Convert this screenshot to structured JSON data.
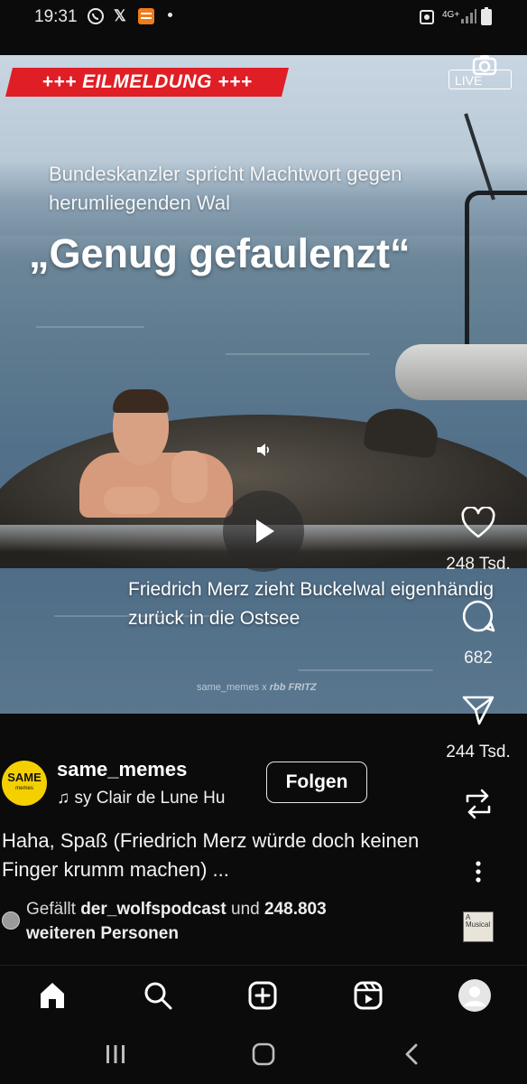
{
  "status_bar": {
    "time": "19:31",
    "network": "4G+",
    "notification_icons": [
      "whatsapp-icon",
      "x-icon",
      "app-badge-icon"
    ]
  },
  "post": {
    "breaking_banner": "+++ EILMELDUNG +++",
    "live_label": "LIVE",
    "subheadline": "Bundeskanzler spricht Machtwort gegen herumliegenden Wal",
    "headline": "„Genug gefaulenzt“",
    "caption": "Friedrich Merz zieht Buckelwal eigenhändig zurück in die Ostsee",
    "watermark": "same_memes x",
    "watermark_brand": "rbb FRITZ"
  },
  "actions": {
    "likes": "248 Tsd.",
    "comments": "682",
    "shares": "244 Tsd."
  },
  "author": {
    "avatar_text": "SAME",
    "avatar_sub": "memes",
    "username": "same_memes",
    "music": "sy Clair de Lune   Hu",
    "follow_label": "Folgen"
  },
  "description": "Haha, Spaß (Friedrich Merz würde doch keinen Finger krumm machen) ...",
  "likes_line": {
    "prefix": "Gefällt ",
    "user": "der_wolfspodcast",
    "middle": " und ",
    "count": "248.803",
    "suffix": "weiteren Personen"
  },
  "album_text": "A Musical",
  "bottom_nav": [
    "home-icon",
    "search-icon",
    "create-icon",
    "reels-icon",
    "profile-icon"
  ],
  "system_nav": [
    "recents-icon",
    "home-button-icon",
    "back-icon"
  ],
  "colors": {
    "background": "#0b0b0c",
    "banner_red": "#e01e25",
    "avatar_yellow": "#f4d000"
  }
}
